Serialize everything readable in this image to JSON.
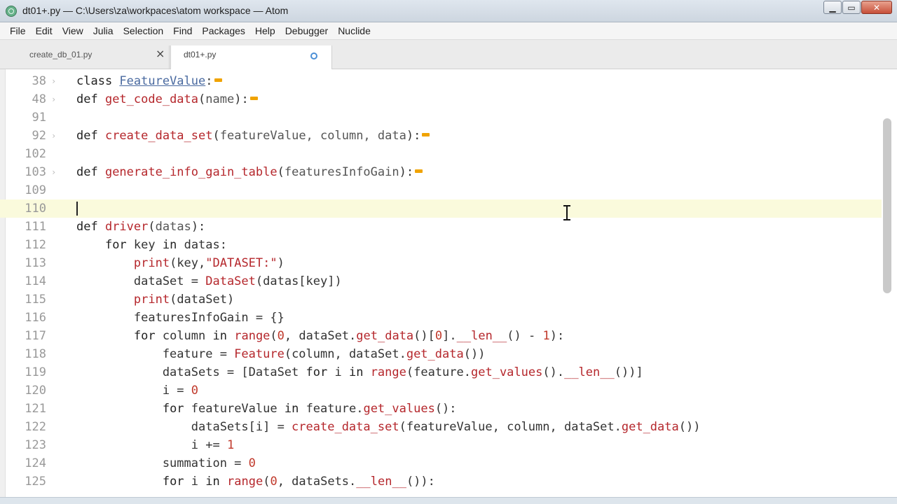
{
  "window": {
    "title": "dt01+.py — C:\\Users\\za\\workpaces\\atom workspace — Atom",
    "min_label": "▁",
    "max_label": "▭",
    "close_label": "✕"
  },
  "menu": [
    "File",
    "Edit",
    "View",
    "Julia",
    "Selection",
    "Find",
    "Packages",
    "Help",
    "Debugger",
    "Nuclide"
  ],
  "tabs": [
    {
      "label": "create_db_01.py",
      "close_label": "×"
    },
    {
      "label": "dt01+.py"
    }
  ],
  "editor": {
    "lines": [
      {
        "n": "38",
        "fold": "›",
        "segs": [
          [
            "kw",
            "class "
          ],
          [
            "cls",
            "FeatureValue"
          ],
          [
            "",
            ":"
          ]
        ],
        "marker": true
      },
      {
        "n": "48",
        "fold": "›",
        "segs": [
          [
            "kw",
            "def "
          ],
          [
            "fn",
            "get_code_data"
          ],
          [
            "",
            "("
          ],
          [
            "param",
            "name"
          ],
          [
            "",
            "):"
          ]
        ],
        "marker": true
      },
      {
        "n": "91",
        "fold": "",
        "segs": []
      },
      {
        "n": "92",
        "fold": "›",
        "segs": [
          [
            "kw",
            "def "
          ],
          [
            "fn",
            "create_data_set"
          ],
          [
            "",
            "("
          ],
          [
            "param",
            "featureValue, column, data"
          ],
          [
            "",
            "):"
          ]
        ],
        "marker": true
      },
      {
        "n": "102",
        "fold": "",
        "segs": []
      },
      {
        "n": "103",
        "fold": "›",
        "segs": [
          [
            "kw",
            "def "
          ],
          [
            "fn",
            "generate_info_gain_table"
          ],
          [
            "",
            "("
          ],
          [
            "param",
            "featuresInfoGain"
          ],
          [
            "",
            "):"
          ]
        ],
        "marker": true
      },
      {
        "n": "109",
        "fold": "",
        "segs": []
      },
      {
        "n": "110",
        "fold": "",
        "segs": [],
        "active": true
      },
      {
        "n": "111",
        "fold": "",
        "segs": [
          [
            "kw",
            "def "
          ],
          [
            "fn",
            "driver"
          ],
          [
            "",
            "("
          ],
          [
            "param",
            "datas"
          ],
          [
            "",
            "):"
          ]
        ]
      },
      {
        "n": "112",
        "fold": "",
        "segs": [
          [
            "",
            "    "
          ],
          [
            "kw",
            "for"
          ],
          [
            "",
            " key "
          ],
          [
            "kw",
            "in"
          ],
          [
            "",
            " datas:"
          ]
        ]
      },
      {
        "n": "113",
        "fold": "",
        "segs": [
          [
            "",
            "        "
          ],
          [
            "fn",
            "print"
          ],
          [
            "",
            "(key,"
          ],
          [
            "str",
            "\"DATASET:\""
          ],
          [
            "",
            ")"
          ]
        ]
      },
      {
        "n": "114",
        "fold": "",
        "segs": [
          [
            "",
            "        dataSet = "
          ],
          [
            "fn",
            "DataSet"
          ],
          [
            "",
            "(datas[key])"
          ]
        ]
      },
      {
        "n": "115",
        "fold": "",
        "segs": [
          [
            "",
            "        "
          ],
          [
            "fn",
            "print"
          ],
          [
            "",
            "(dataSet)"
          ]
        ]
      },
      {
        "n": "116",
        "fold": "",
        "segs": [
          [
            "",
            "        featuresInfoGain = {}"
          ]
        ]
      },
      {
        "n": "117",
        "fold": "",
        "segs": [
          [
            "",
            "        "
          ],
          [
            "kw",
            "for"
          ],
          [
            "",
            " column "
          ],
          [
            "kw",
            "in"
          ],
          [
            "",
            " "
          ],
          [
            "fn",
            "range"
          ],
          [
            "",
            "("
          ],
          [
            "num",
            "0"
          ],
          [
            "",
            ", dataSet."
          ],
          [
            "attr",
            "get_data"
          ],
          [
            "",
            "()["
          ],
          [
            "num",
            "0"
          ],
          [
            "",
            "]."
          ],
          [
            "attr",
            "__len__"
          ],
          [
            "",
            "() - "
          ],
          [
            "num",
            "1"
          ],
          [
            "",
            "):"
          ]
        ]
      },
      {
        "n": "118",
        "fold": "",
        "segs": [
          [
            "",
            "            feature = "
          ],
          [
            "fn",
            "Feature"
          ],
          [
            "",
            "(column, dataSet."
          ],
          [
            "attr",
            "get_data"
          ],
          [
            "",
            "())"
          ]
        ]
      },
      {
        "n": "119",
        "fold": "",
        "segs": [
          [
            "",
            "            dataSets = [DataSet "
          ],
          [
            "kw",
            "for"
          ],
          [
            "",
            " i "
          ],
          [
            "kw",
            "in"
          ],
          [
            "",
            " "
          ],
          [
            "fn",
            "range"
          ],
          [
            "",
            "(feature."
          ],
          [
            "attr",
            "get_values"
          ],
          [
            "",
            "()."
          ],
          [
            "attr",
            "__len__"
          ],
          [
            "",
            "())]"
          ]
        ]
      },
      {
        "n": "120",
        "fold": "",
        "segs": [
          [
            "",
            "            i = "
          ],
          [
            "num",
            "0"
          ]
        ]
      },
      {
        "n": "121",
        "fold": "",
        "segs": [
          [
            "",
            "            "
          ],
          [
            "kw",
            "for"
          ],
          [
            "",
            " featureValue "
          ],
          [
            "kw",
            "in"
          ],
          [
            "",
            " feature."
          ],
          [
            "attr",
            "get_values"
          ],
          [
            "",
            "():"
          ]
        ]
      },
      {
        "n": "122",
        "fold": "",
        "segs": [
          [
            "",
            "                dataSets[i] = "
          ],
          [
            "fn",
            "create_data_set"
          ],
          [
            "",
            "(featureValue, column, dataSet."
          ],
          [
            "attr",
            "get_data"
          ],
          [
            "",
            "())"
          ]
        ]
      },
      {
        "n": "123",
        "fold": "",
        "segs": [
          [
            "",
            "                i += "
          ],
          [
            "num",
            "1"
          ]
        ]
      },
      {
        "n": "124",
        "fold": "",
        "segs": [
          [
            "",
            "            summation = "
          ],
          [
            "num",
            "0"
          ]
        ]
      },
      {
        "n": "125",
        "fold": "",
        "segs": [
          [
            "",
            "            "
          ],
          [
            "kw",
            "for"
          ],
          [
            "",
            " i "
          ],
          [
            "kw",
            "in"
          ],
          [
            "",
            " "
          ],
          [
            "fn",
            "range"
          ],
          [
            "",
            "("
          ],
          [
            "num",
            "0"
          ],
          [
            "",
            ", dataSets."
          ],
          [
            "attr",
            "__len__"
          ],
          [
            "",
            "()):"
          ]
        ]
      }
    ]
  }
}
